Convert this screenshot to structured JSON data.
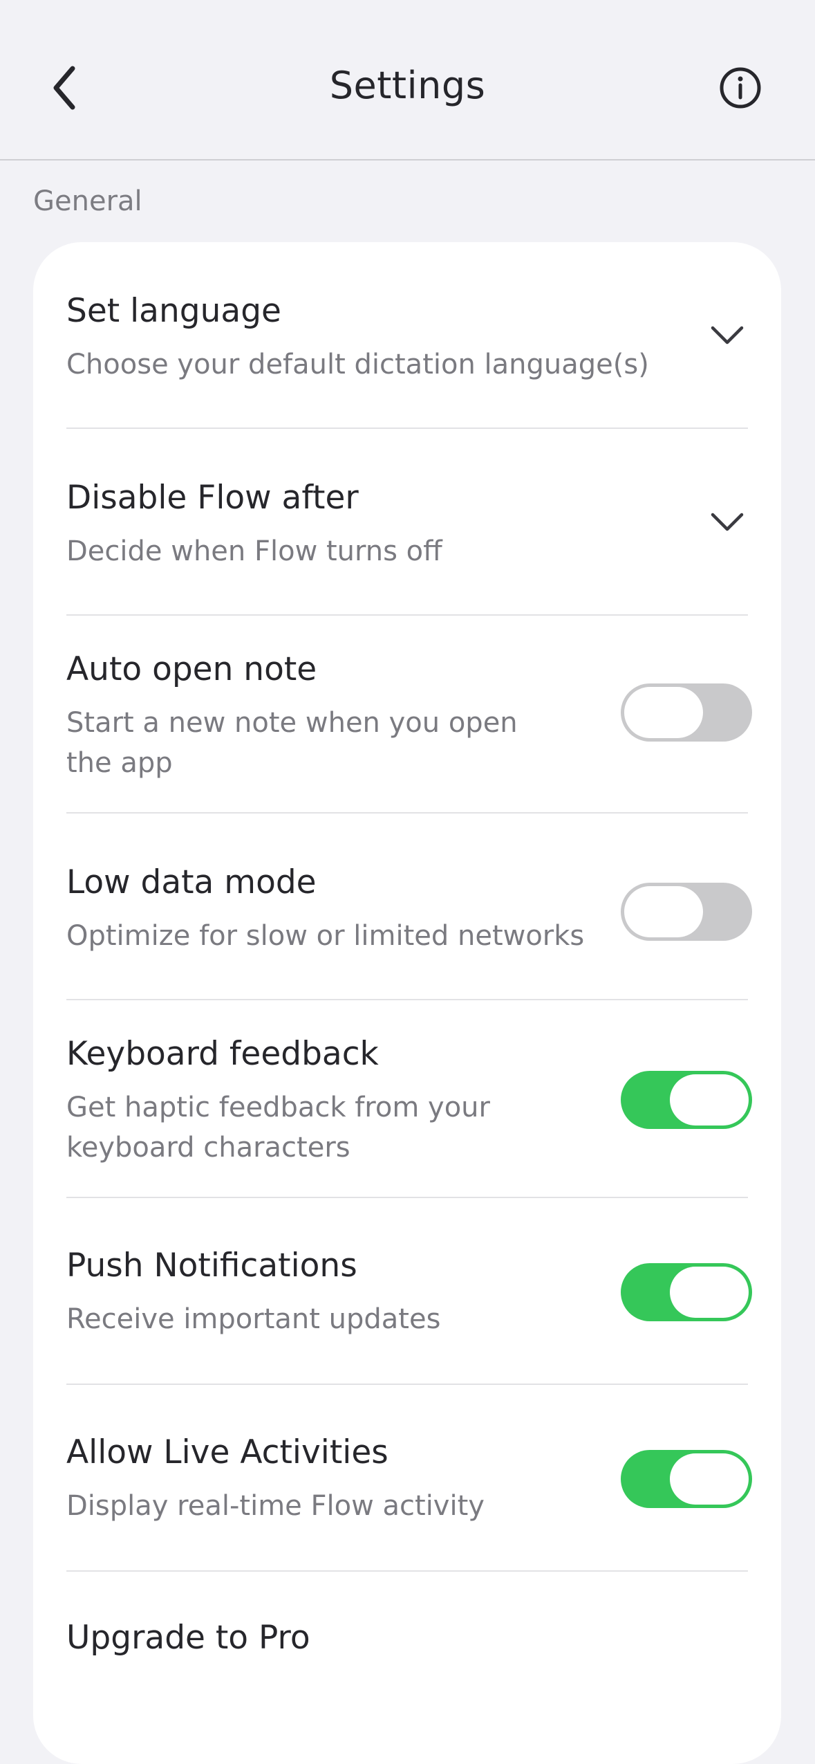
{
  "header": {
    "title": "Settings",
    "back_icon": "chevron-left-icon",
    "info_icon": "info-circle-icon"
  },
  "section": {
    "label": "General"
  },
  "rows": [
    {
      "title": "Set language",
      "subtitle": "Choose your default dictation language(s)",
      "control": "dropdown"
    },
    {
      "title": "Disable Flow after",
      "subtitle": "Decide when Flow turns off",
      "control": "dropdown"
    },
    {
      "title": "Auto open note",
      "subtitle": "Start a new note when you open the app",
      "control": "toggle",
      "on": false
    },
    {
      "title": "Low data mode",
      "subtitle": "Optimize for slow or limited networks",
      "control": "toggle",
      "on": false
    },
    {
      "title": "Keyboard feedback",
      "subtitle": "Get haptic feedback from your keyboard characters",
      "control": "toggle",
      "on": true
    },
    {
      "title": "Push Notifications",
      "subtitle": "Receive important updates",
      "control": "toggle",
      "on": true
    },
    {
      "title": "Allow Live Activities",
      "subtitle": "Display real-time Flow activity",
      "control": "toggle",
      "on": true
    },
    {
      "title": "Upgrade to Pro",
      "subtitle": "",
      "control": "none"
    }
  ],
  "colors": {
    "toggle_on": "#35c759",
    "toggle_off": "#c9c9cb",
    "background": "#f2f2f6"
  }
}
